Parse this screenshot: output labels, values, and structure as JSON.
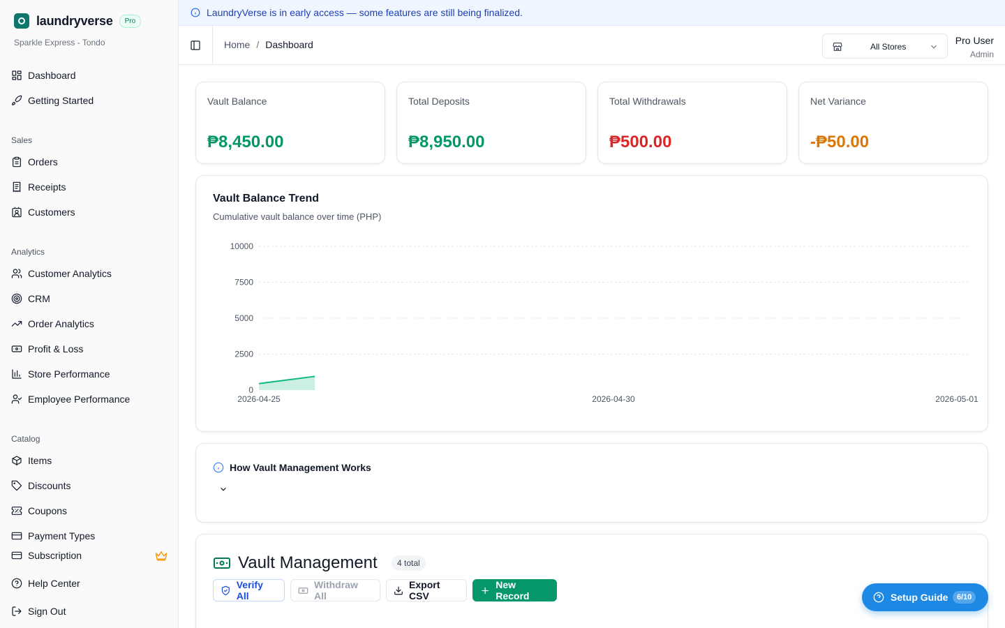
{
  "brand": {
    "name": "laundryverse",
    "plan_badge": "Pro",
    "store_name": "Sparkle Express - Tondo"
  },
  "nav": {
    "top": [
      {
        "label": "Dashboard",
        "icon": "dashboard-icon"
      },
      {
        "label": "Getting Started",
        "icon": "rocket-icon"
      }
    ],
    "sales_heading": "Sales",
    "sales": [
      {
        "label": "Orders",
        "icon": "clipboard-icon"
      },
      {
        "label": "Receipts",
        "icon": "receipt-icon"
      },
      {
        "label": "Customers",
        "icon": "contact-icon"
      }
    ],
    "analytics_heading": "Analytics",
    "analytics": [
      {
        "label": "Customer Analytics",
        "icon": "users-icon"
      },
      {
        "label": "CRM",
        "icon": "target-icon"
      },
      {
        "label": "Order Analytics",
        "icon": "trend-icon"
      },
      {
        "label": "Profit & Loss",
        "icon": "banknote-icon"
      },
      {
        "label": "Store Performance",
        "icon": "bar-chart-icon"
      },
      {
        "label": "Employee Performance",
        "icon": "user-check-icon"
      }
    ],
    "catalog_heading": "Catalog",
    "catalog": [
      {
        "label": "Items",
        "icon": "package-icon"
      },
      {
        "label": "Discounts",
        "icon": "tag-icon"
      },
      {
        "label": "Coupons",
        "icon": "ticket-icon"
      },
      {
        "label": "Payment Types",
        "icon": "card-icon"
      }
    ],
    "footer": [
      {
        "label": "Subscription",
        "icon": "card-icon"
      },
      {
        "label": "Help Center",
        "icon": "help-icon"
      },
      {
        "label": "Sign Out",
        "icon": "logout-icon"
      }
    ]
  },
  "banner": {
    "text": "LaundryVerse is in early access — some features are still being finalized."
  },
  "header": {
    "breadcrumb_home": "Home",
    "breadcrumb_sep": "/",
    "breadcrumb_current": "Dashboard",
    "store_select": "All Stores",
    "user_name": "Pro User",
    "user_role": "Admin"
  },
  "stats": [
    {
      "label": "Vault Balance",
      "value": "₱8,450.00",
      "color": "#059669"
    },
    {
      "label": "Total Deposits",
      "value": "₱8,950.00",
      "color": "#059669"
    },
    {
      "label": "Total Withdrawals",
      "value": "₱500.00",
      "color": "#dc2626"
    },
    {
      "label": "Net Variance",
      "value": "-₱50.00",
      "color": "#d97706"
    }
  ],
  "trend": {
    "title": "Vault Balance Trend",
    "subtitle": "Cumulative vault balance over time (PHP)"
  },
  "chart_data": {
    "type": "area",
    "title": "Vault Balance Trend",
    "subtitle": "Cumulative vault balance over time (PHP)",
    "x_ticks": [
      "2026-04-25",
      "2026-04-30",
      "2026-05-01"
    ],
    "y_ticks": [
      0,
      2500,
      5000,
      7500,
      10000
    ],
    "ylim": [
      0,
      10000
    ],
    "grid": true,
    "color": "#10b981",
    "points": [
      {
        "x": "2026-04-25",
        "y": 450
      },
      {
        "x": "2026-04-25b",
        "y": 950
      }
    ]
  },
  "how": {
    "title": "How Vault Management Works"
  },
  "vault": {
    "title": "Vault Management",
    "count": "4 total",
    "verify_label": "Verify All",
    "withdraw_label": "Withdraw All",
    "export_label": "Export CSV",
    "new_label": "New Record"
  },
  "setup": {
    "label": "Setup Guide",
    "count": "6/10"
  }
}
